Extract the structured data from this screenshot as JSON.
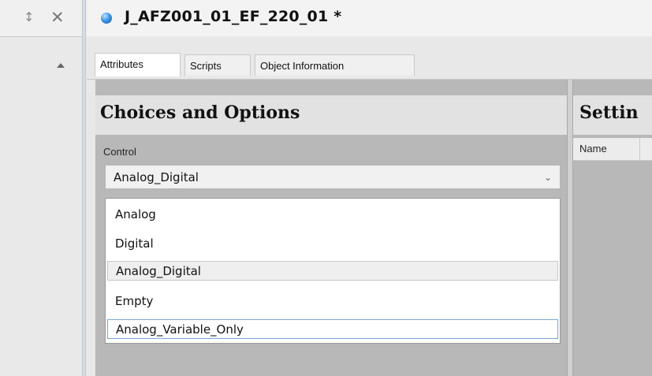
{
  "left_panel": {
    "pin_icon": "pin-icon",
    "close_icon": "close-icon",
    "collapse_icon": "caret-up-icon"
  },
  "titlebar": {
    "icon": "globe-icon",
    "title": "J_AFZ001_01_EF_220_01 *"
  },
  "tabs": [
    {
      "label": "Attributes",
      "active": true
    },
    {
      "label": "Scripts",
      "active": false
    },
    {
      "label": "Object Information",
      "active": false
    }
  ],
  "choices_panel": {
    "title": "Choices and Options",
    "control_label": "Control",
    "selected_value": "Analog_Digital",
    "options": [
      {
        "label": "Analog",
        "state": "normal"
      },
      {
        "label": "Digital",
        "state": "normal"
      },
      {
        "label": "Analog_Digital",
        "state": "hover"
      },
      {
        "label": "Empty",
        "state": "normal"
      },
      {
        "label": "Analog_Variable_Only",
        "state": "focused"
      }
    ]
  },
  "settings_panel": {
    "title": "Settin",
    "column_name": "Name"
  }
}
